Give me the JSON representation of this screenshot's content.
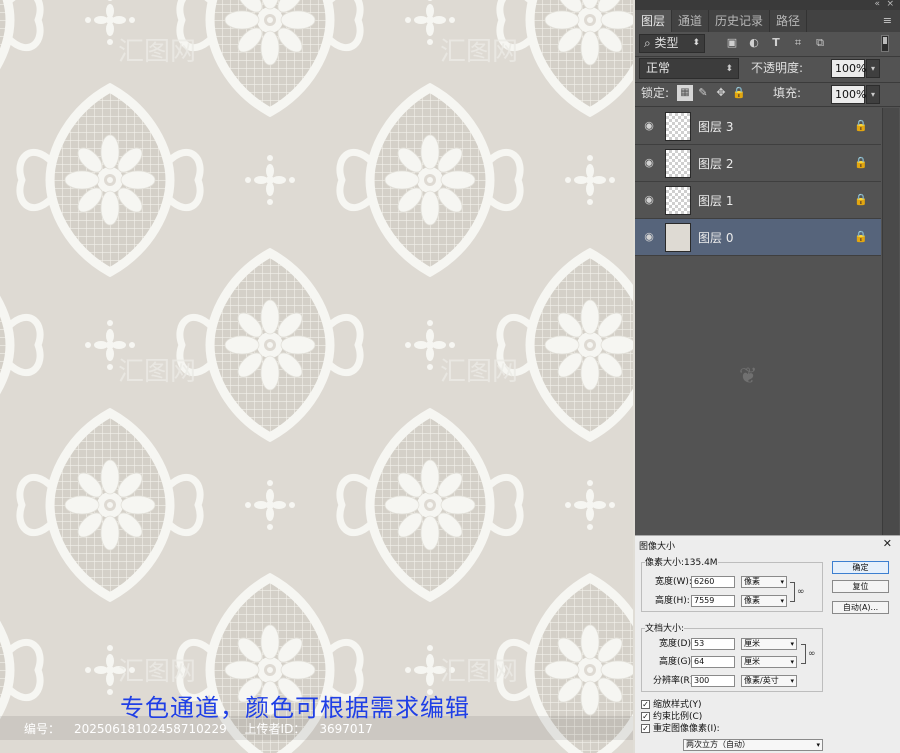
{
  "caption": "专色通道，颜色可根据需求编辑",
  "footer": {
    "id_label": "编号：",
    "id_value": "20250618102458710229",
    "uploader_label": "上传者ID：",
    "uploader_value": "3697017"
  },
  "watermark_text": "汇图网 www.huitu.com",
  "colors": {
    "pattern_bg": "#dedad3",
    "ornament": "#f6f6f2",
    "grid": "#c9c5bd",
    "panel_bg": "#535353",
    "selected_layer": "#56647b",
    "caption_blue": "#1f3fe6"
  },
  "panel": {
    "tabs": [
      "图层",
      "通道",
      "历史记录",
      "路径"
    ],
    "active_tab": "图层",
    "filter": {
      "kind_label": "类型",
      "icons": [
        "image-filter-icon",
        "adjustment-filter-icon",
        "text-filter-icon",
        "shape-filter-icon",
        "smart-object-filter-icon"
      ]
    },
    "blend_mode": "正常",
    "opacity_label": "不透明度:",
    "opacity_value": "100%",
    "lock_label": "锁定:",
    "fill_label": "填充:",
    "fill_value": "100%",
    "layers": [
      {
        "name": "图层 3",
        "selected": false,
        "transparent": true
      },
      {
        "name": "图层 2",
        "selected": false,
        "transparent": true
      },
      {
        "name": "图层 1",
        "selected": false,
        "transparent": true
      },
      {
        "name": "图层 0",
        "selected": true,
        "transparent": false
      }
    ]
  },
  "dialog": {
    "title": "图像大小",
    "pixel_size": "像素大小:135.4M",
    "width_label": "宽度(W):",
    "width_value": "6260",
    "width_unit": "像素",
    "height_label": "高度(H):",
    "height_value": "7559",
    "height_unit": "像素",
    "doc_size_label": "文档大小:",
    "doc_width_label": "宽度(D):",
    "doc_width_value": "53",
    "doc_width_unit": "厘米",
    "doc_height_label": "高度(G):",
    "doc_height_value": "64",
    "doc_height_unit": "厘米",
    "resolution_label": "分辨率(R):",
    "resolution_value": "300",
    "resolution_unit": "像素/英寸",
    "scale_styles": "缩放样式(Y)",
    "constrain": "约束比例(C)",
    "resample": "重定图像像素(I):",
    "resample_method": "两次立方（自动）",
    "ok_button": "确定",
    "reset_button": "复位",
    "auto_button": "自动(A)..."
  }
}
